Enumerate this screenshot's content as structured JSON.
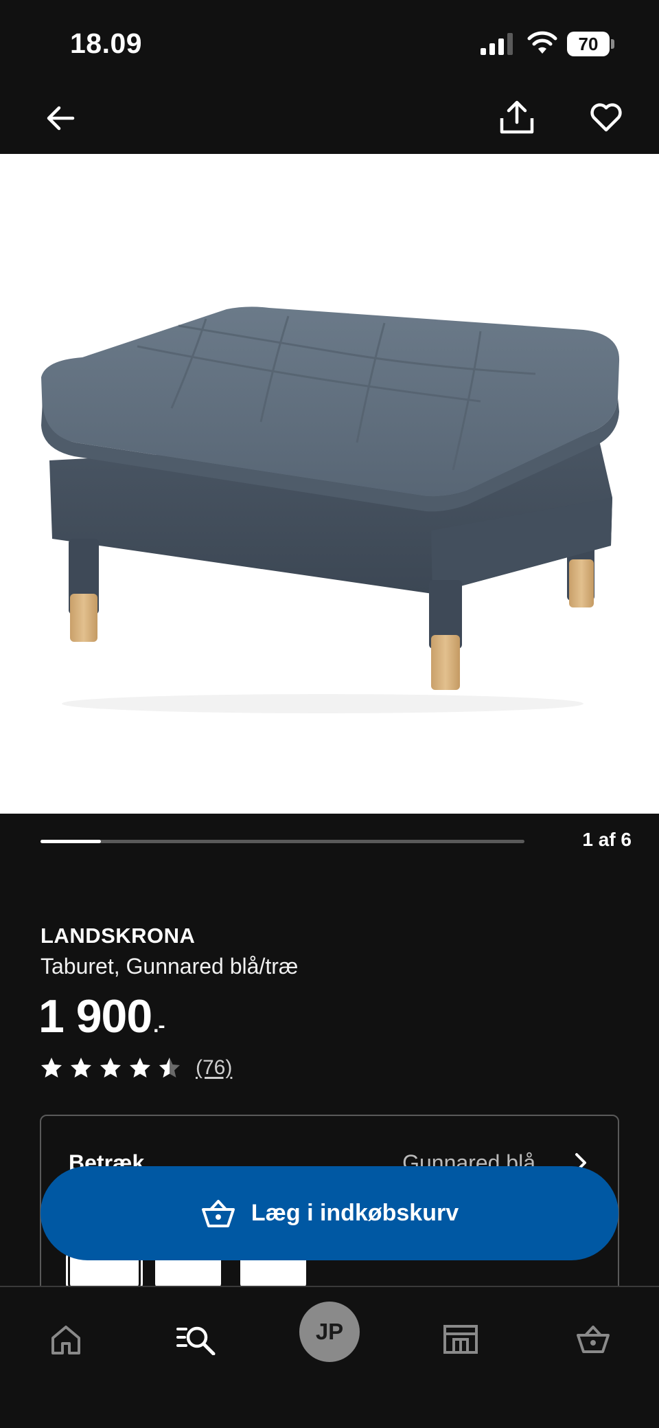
{
  "status_bar": {
    "time": "18.09",
    "battery_level": "70"
  },
  "header": {
    "back_icon": "arrow-left-icon",
    "share_icon": "share-icon",
    "favorite_icon": "heart-icon"
  },
  "gallery": {
    "counter": "1 af 6",
    "progress": 0.125
  },
  "product": {
    "name": "LANDSKRONA",
    "description": "Taburet, Gunnared blå/træ",
    "price": "1 900",
    "price_suffix": ".-",
    "rating": 4.5,
    "review_count": "(76)"
  },
  "option": {
    "label": "Betræk",
    "value": "Gunnared blå",
    "swatch_count": 3
  },
  "cta": {
    "label": "Læg i indkøbskurv",
    "color": "#0058a3"
  },
  "bottom_nav": {
    "items": [
      "home-icon",
      "search-list-icon",
      "profile-avatar",
      "store-icon",
      "basket-icon"
    ],
    "avatar_initials": "JP"
  }
}
